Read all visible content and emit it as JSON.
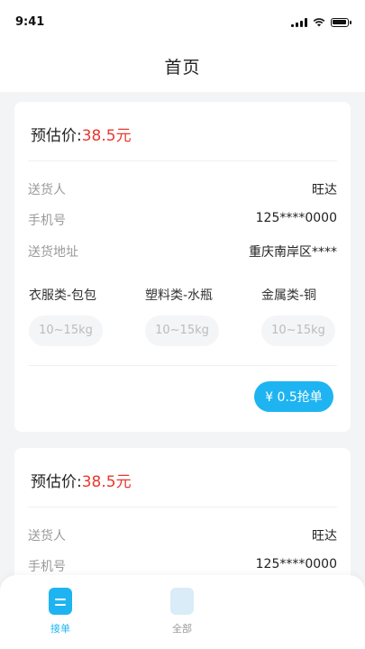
{
  "status_bar": {
    "time": "9:41"
  },
  "header": {
    "title": "首页"
  },
  "orders": [
    {
      "price_label": "预估价:",
      "price_value": "38.5元",
      "sender_label": "送货人",
      "sender_value": "旺达",
      "phone_label": "手机号",
      "phone_value": "125****0000",
      "address_label": "送货地址",
      "address_value": "重庆南岸区****",
      "categories": [
        {
          "name": "衣服类-包包",
          "weight": "10~15kg"
        },
        {
          "name": "塑料类-水瓶",
          "weight": "10~15kg"
        },
        {
          "name": "金属类-铜",
          "weight": "10~15kg"
        }
      ],
      "grab_label": "¥ 0.5抢单"
    },
    {
      "price_label": "预估价:",
      "price_value": "38.5元",
      "sender_label": "送货人",
      "sender_value": "旺达",
      "phone_label": "手机号",
      "phone_value": "125****0000"
    }
  ],
  "tab_bar": {
    "tabs": [
      {
        "label": "接单",
        "active": true
      },
      {
        "label": "全部",
        "active": false
      }
    ]
  },
  "colors": {
    "accent": "#1eb4f1",
    "price": "#e8382f",
    "background": "#f3f4f6"
  }
}
